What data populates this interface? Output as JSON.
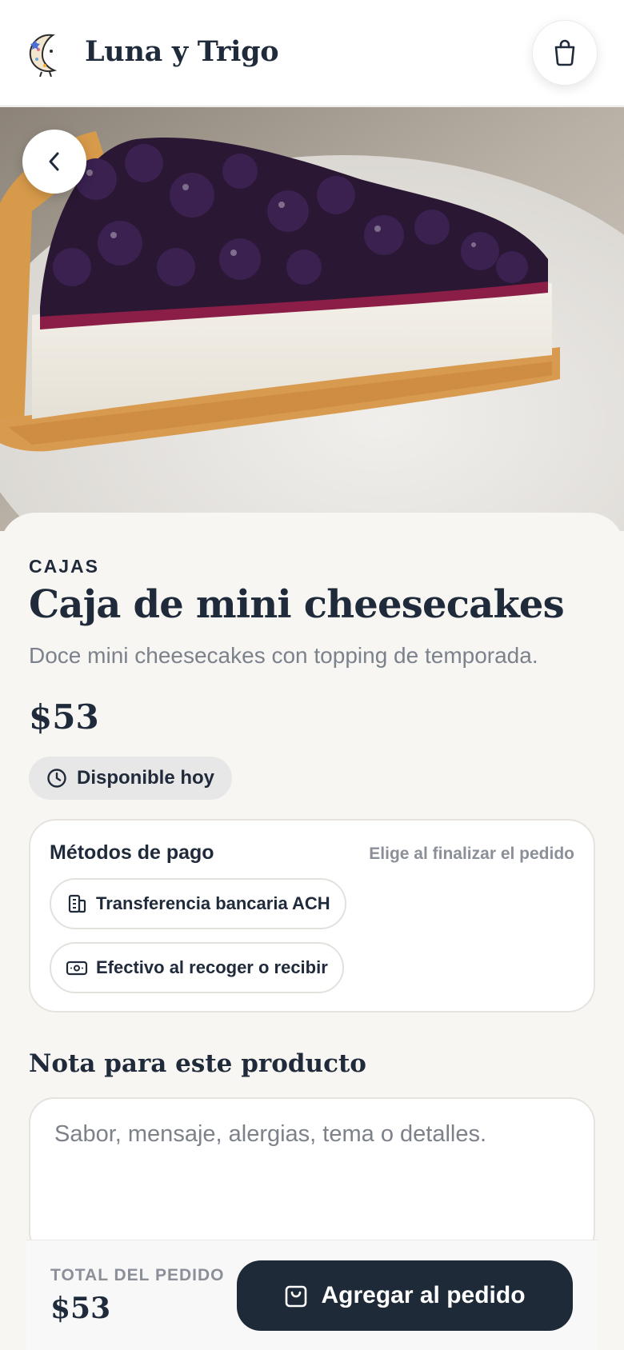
{
  "header": {
    "brand": "Luna y Trigo",
    "cart_icon": "shopping-bag-icon",
    "logo_icon": "moon-cookie-logo"
  },
  "hero": {
    "image_desc": "cheesecake-slice-photo",
    "back_icon": "chevron-left-icon"
  },
  "product": {
    "category": "CAJAS",
    "title": "Caja de mini cheesecakes",
    "description": "Doce mini cheesecakes con topping de temporada.",
    "price": "$53",
    "availability": "Disponible hoy",
    "availability_icon": "clock-icon"
  },
  "payment": {
    "title": "Métodos de pago",
    "hint": "Elige al finalizar el pedido",
    "methods": [
      {
        "label": "Transferencia bancaria ACH",
        "icon": "bank-icon"
      },
      {
        "label": "Efectivo al recoger o recibir",
        "icon": "cash-icon"
      }
    ]
  },
  "note": {
    "label": "Nota para este producto",
    "placeholder": "Sabor, mensaje, alergias, tema o detalles."
  },
  "footer": {
    "total_label": "TOTAL DEL PEDIDO",
    "total_value": "$53",
    "add_label": "Agregar al pedido",
    "add_icon": "shopping-bag-icon"
  },
  "colors": {
    "primary": "#1e2a38",
    "background": "#f8f6f2",
    "muted": "#8a8f98"
  }
}
